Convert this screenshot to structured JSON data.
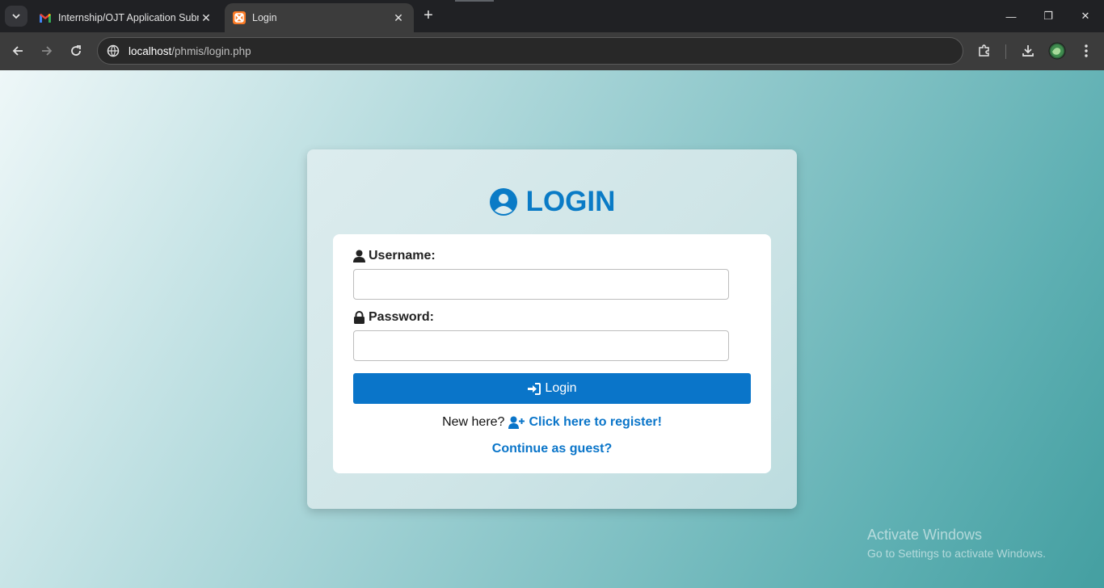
{
  "browser": {
    "tabs": [
      {
        "title": "Internship/OJT Application Subm",
        "icon": "gmail-icon",
        "active": false
      },
      {
        "title": "Login",
        "icon": "xampp-icon",
        "active": true
      }
    ],
    "new_tab_label": "+",
    "address": {
      "host": "localhost",
      "path": "/phmis/login.php"
    },
    "window_controls": {
      "minimize": "—",
      "restore": "❐",
      "close": "✕"
    }
  },
  "login": {
    "title": "LOGIN",
    "username_label": "Username:",
    "username_value": "",
    "password_label": "Password:",
    "password_value": "",
    "submit_label": "Login",
    "register_prompt": "New here?",
    "register_link": "Click here to register!",
    "guest_link": "Continue as guest?"
  },
  "watermark": {
    "line1": "Activate Windows",
    "line2": "Go to Settings to activate Windows."
  },
  "colors": {
    "accent": "#0a75c9",
    "title": "#0a7bc6",
    "chrome_bg": "#202124",
    "toolbar_bg": "#3c3c3c"
  }
}
